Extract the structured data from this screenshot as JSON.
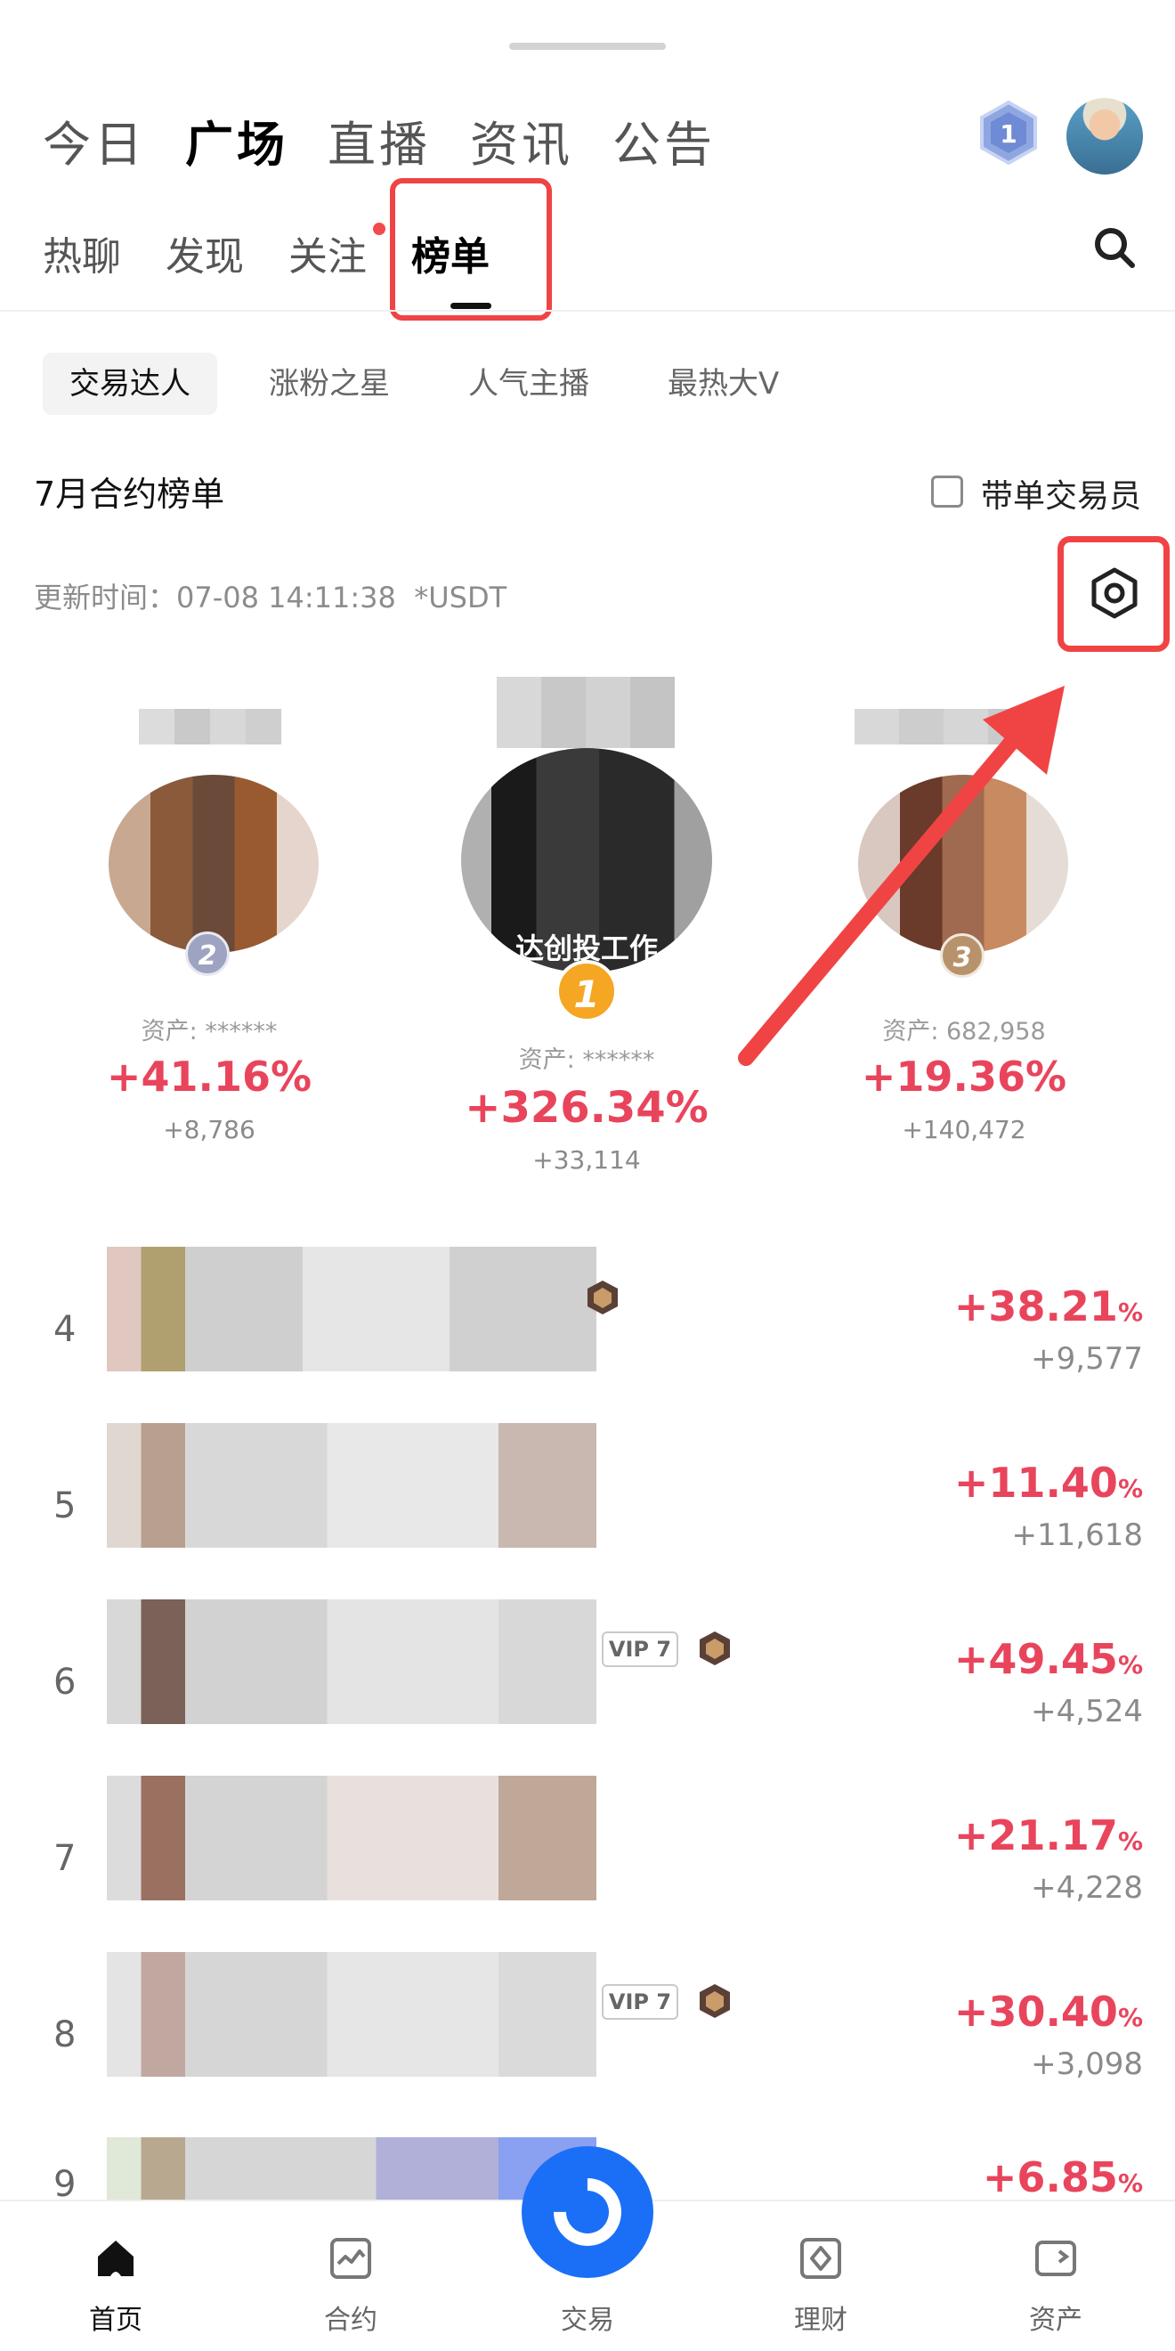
{
  "colors": {
    "accent_red": "#e8455c",
    "highlight_red": "#f04444",
    "trade_blue": "#1a6ff6",
    "gold": "#f5a623"
  },
  "header": {
    "main_tabs": [
      "今日",
      "广场",
      "直播",
      "资讯",
      "公告"
    ],
    "active_main_tab": "广场",
    "level_badge": "1",
    "sub_tabs": [
      "热聊",
      "发现",
      "关注",
      "榜单"
    ],
    "active_sub_tab": "榜单"
  },
  "categories": [
    "交易达人",
    "涨粉之星",
    "人气主播",
    "最热大V"
  ],
  "section": {
    "title": "7月合约榜单",
    "checkbox_label": "带单交易员",
    "update_prefix": "更新时间：",
    "update_time": "07-08 14:11:38",
    "currency_note": "*USDT"
  },
  "podium": {
    "first": {
      "rank": "1",
      "banner": "达创投工作",
      "assets": "资产: ******",
      "pct": "+326.34%",
      "pnl": "+33,114"
    },
    "second": {
      "rank": "2",
      "assets": "资产: ******",
      "pct": "+41.16%",
      "pnl": "+8,786"
    },
    "third": {
      "rank": "3",
      "assets": "资产: 682,958",
      "pct": "+19.36%",
      "pnl": "+140,472"
    }
  },
  "list": [
    {
      "rank": "4",
      "pct": "+38.21",
      "pct_unit": "%",
      "pnl": "+9,577"
    },
    {
      "rank": "5",
      "pct": "+11.40",
      "pct_unit": "%",
      "pnl": "+11,618"
    },
    {
      "rank": "6",
      "pct": "+49.45",
      "pct_unit": "%",
      "pnl": "+4,524",
      "vip": "VIP 7"
    },
    {
      "rank": "7",
      "pct": "+21.17",
      "pct_unit": "%",
      "pnl": "+4,228"
    },
    {
      "rank": "8",
      "pct": "+30.40",
      "pct_unit": "%",
      "pnl": "+3,098",
      "vip": "VIP 7"
    },
    {
      "rank": "9",
      "pct": "+6.85",
      "pct_unit": "%",
      "pnl": ""
    }
  ],
  "bottom_nav": [
    {
      "label": "首页",
      "icon": "home-icon",
      "active": true
    },
    {
      "label": "合约",
      "icon": "futures-chart-icon"
    },
    {
      "label": "交易",
      "icon": "trade-icon"
    },
    {
      "label": "理财",
      "icon": "earn-icon"
    },
    {
      "label": "资产",
      "icon": "wallet-icon"
    }
  ]
}
